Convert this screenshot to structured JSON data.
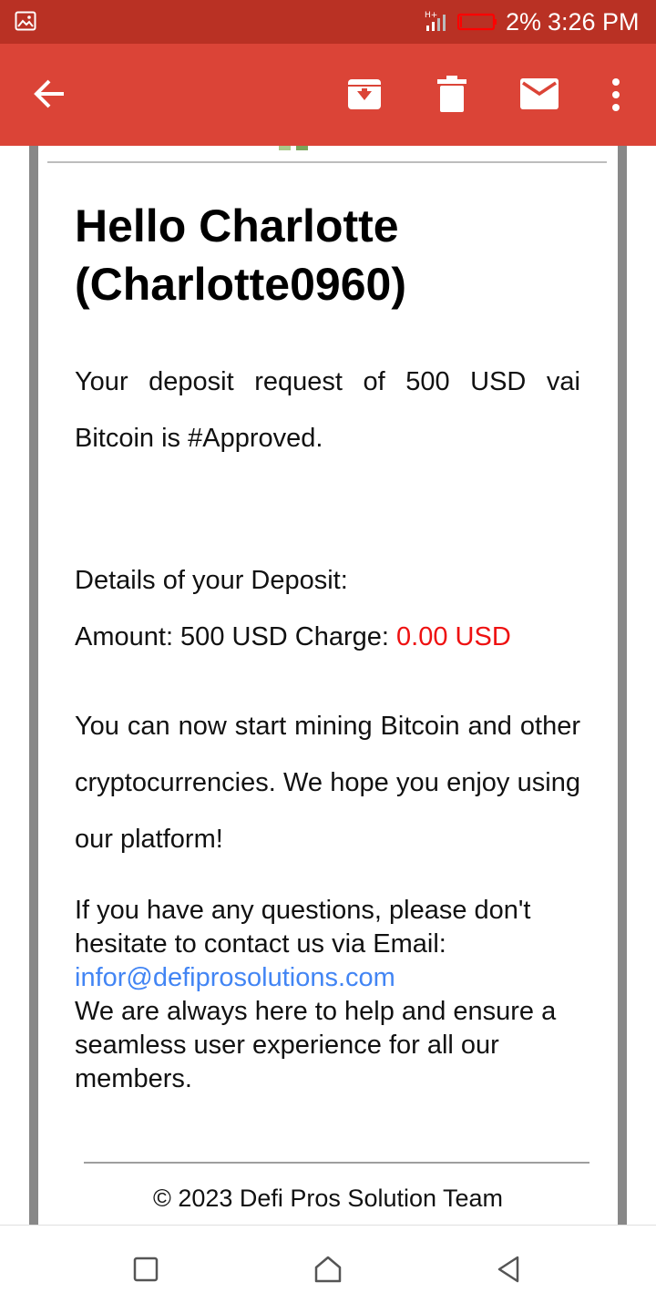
{
  "status_bar": {
    "network_type": "H+",
    "battery_percent": "2%",
    "time": "3:26 PM",
    "colors": {
      "background": "#b93124",
      "battery_outline": "#ff0000"
    },
    "icons": [
      "gallery-notification-icon",
      "signal-icon",
      "battery-icon"
    ]
  },
  "toolbar": {
    "background": "#db4437",
    "icons": [
      "back-arrow-icon",
      "archive-icon",
      "delete-icon",
      "mark-unread-icon",
      "more-options-icon"
    ]
  },
  "email": {
    "greeting": "Hello Charlotte (Charlotte0960)",
    "deposit_message": "Your deposit request of 500 USD vai Bitcoin is #Approved.",
    "details_heading": "Details of your Deposit:",
    "amount_label": "Amount: 500 USD Charge:",
    "charge_value": "0.00 USD",
    "mining_message": "You can now start mining Bitcoin and other cryptocurrencies. We hope you enjoy using our platform!",
    "contact_text": "If you have any questions, please don't hesitate to contact us via Email:",
    "contact_email": "infor@defiprosolutions.com",
    "help_text": "We are always here to help and ensure a seamless user experience for all our members.",
    "footer": "© 2023 Defi Pros Solution Team",
    "colors": {
      "charge": "#ee1111",
      "link": "#4285f4",
      "frame": "#888888"
    }
  },
  "nav_bar": {
    "icons": [
      "recent-apps-icon",
      "home-icon",
      "back-icon"
    ]
  }
}
